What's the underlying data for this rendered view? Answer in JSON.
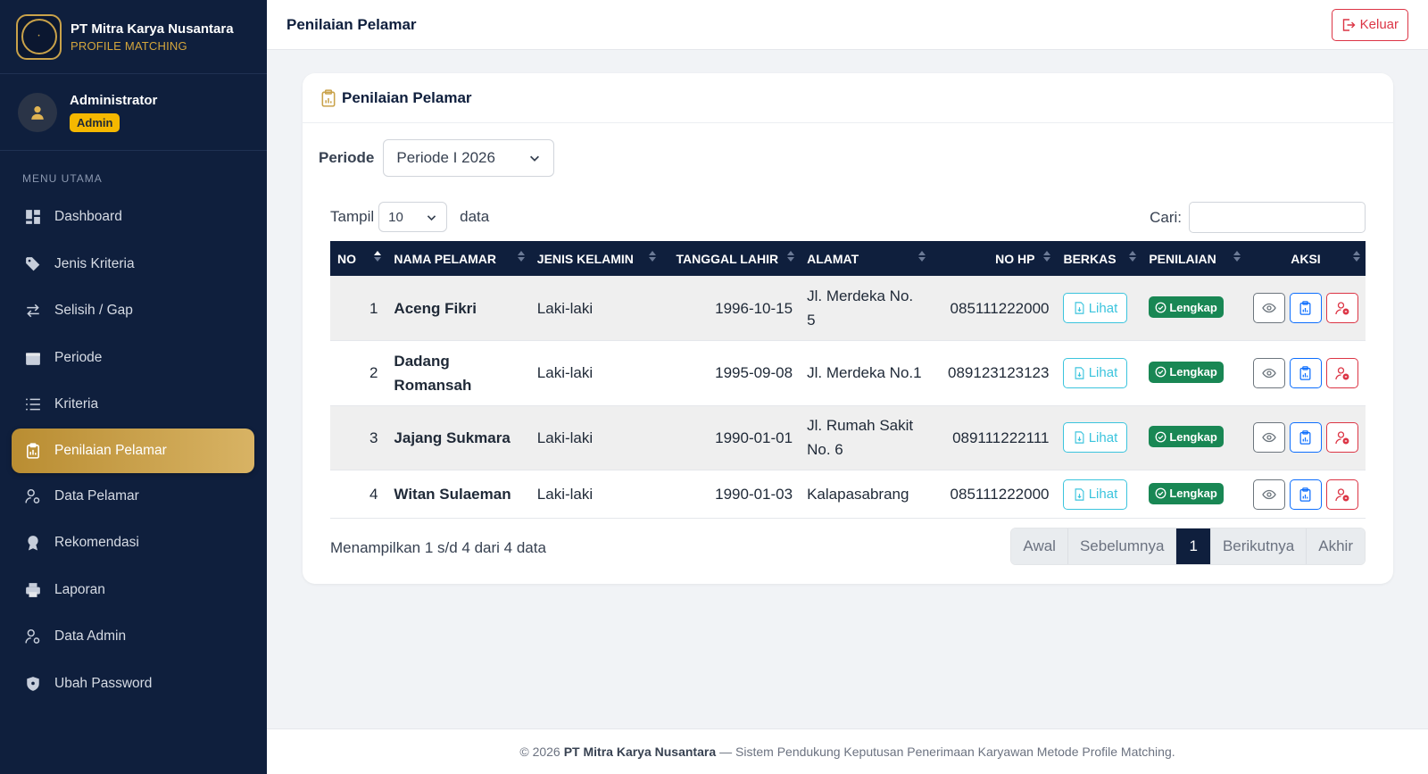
{
  "brand": {
    "name": "PT Mitra Karya Nusantara",
    "subtitle": "PROFILE MATCHING"
  },
  "user": {
    "name": "Administrator",
    "role": "Admin"
  },
  "sidebar": {
    "section_title": "MENU UTAMA",
    "items": [
      {
        "label": "Dashboard",
        "icon": "dashboard-icon"
      },
      {
        "label": "Jenis Kriteria",
        "icon": "tag-icon"
      },
      {
        "label": "Selisih / Gap",
        "icon": "swap-arrows-icon"
      },
      {
        "label": "Periode",
        "icon": "calendar-icon"
      },
      {
        "label": "Kriteria",
        "icon": "list-icon"
      },
      {
        "label": "Penilaian Pelamar",
        "icon": "clipboard-icon",
        "active": true
      },
      {
        "label": "Data Pelamar",
        "icon": "user-gear-icon"
      },
      {
        "label": "Rekomendasi",
        "icon": "award-icon"
      },
      {
        "label": "Laporan",
        "icon": "printer-icon"
      },
      {
        "label": "Data Admin",
        "icon": "user-gear-icon"
      },
      {
        "label": "Ubah Password",
        "icon": "shield-icon"
      }
    ]
  },
  "topbar": {
    "title": "Penilaian Pelamar",
    "logout_label": "Keluar"
  },
  "card": {
    "title": "Penilaian Pelamar"
  },
  "filter": {
    "period_label": "Periode",
    "period_value": "Periode I 2026"
  },
  "table_controls": {
    "show_label": "Tampil",
    "page_length": "10",
    "data_label": "data",
    "search_label": "Cari:",
    "search_value": ""
  },
  "table": {
    "headers": [
      "NO",
      "NAMA PELAMAR",
      "JENIS KELAMIN",
      "TANGGAL LAHIR",
      "ALAMAT",
      "NO HP",
      "BERKAS",
      "PENILAIAN",
      "AKSI"
    ],
    "rows": [
      {
        "no": "1",
        "name": "Aceng Fikri",
        "gender": "Laki-laki",
        "dob": "1996-10-15",
        "address": "Jl. Merdeka No. 5",
        "phone": "085111222000",
        "file": "Lihat",
        "status": "Lengkap"
      },
      {
        "no": "2",
        "name": "Dadang Romansah",
        "gender": "Laki-laki",
        "dob": "1995-09-08",
        "address": "Jl. Merdeka No.1",
        "phone": "089123123123",
        "file": "Lihat",
        "status": "Lengkap"
      },
      {
        "no": "3",
        "name": "Jajang Sukmara",
        "gender": "Laki-laki",
        "dob": "1990-01-01",
        "address": "Jl. Rumah Sakit No. 6",
        "phone": "089111222111",
        "file": "Lihat",
        "status": "Lengkap"
      },
      {
        "no": "4",
        "name": "Witan Sulaeman",
        "gender": "Laki-laki",
        "dob": "1990-01-03",
        "address": "Kalapasabrang",
        "phone": "085111222000",
        "file": "Lihat",
        "status": "Lengkap"
      }
    ]
  },
  "table_info": "Menampilkan 1 s/d 4 dari 4 data",
  "pagination": {
    "first": "Awal",
    "prev": "Sebelumnya",
    "current": "1",
    "next": "Berikutnya",
    "last": "Akhir"
  },
  "footer": {
    "prefix": "© 2026",
    "company": "PT Mitra Karya Nusantara",
    "suffix": "— Sistem Pendukung Keputusan Penerimaan Karyawan Metode Profile Matching."
  },
  "colors": {
    "navy": "#0f1f3d",
    "gold": "#c9a24a",
    "success": "#198754",
    "danger": "#dc3545",
    "info": "#3bc4dd",
    "primary": "#0d6efd"
  }
}
